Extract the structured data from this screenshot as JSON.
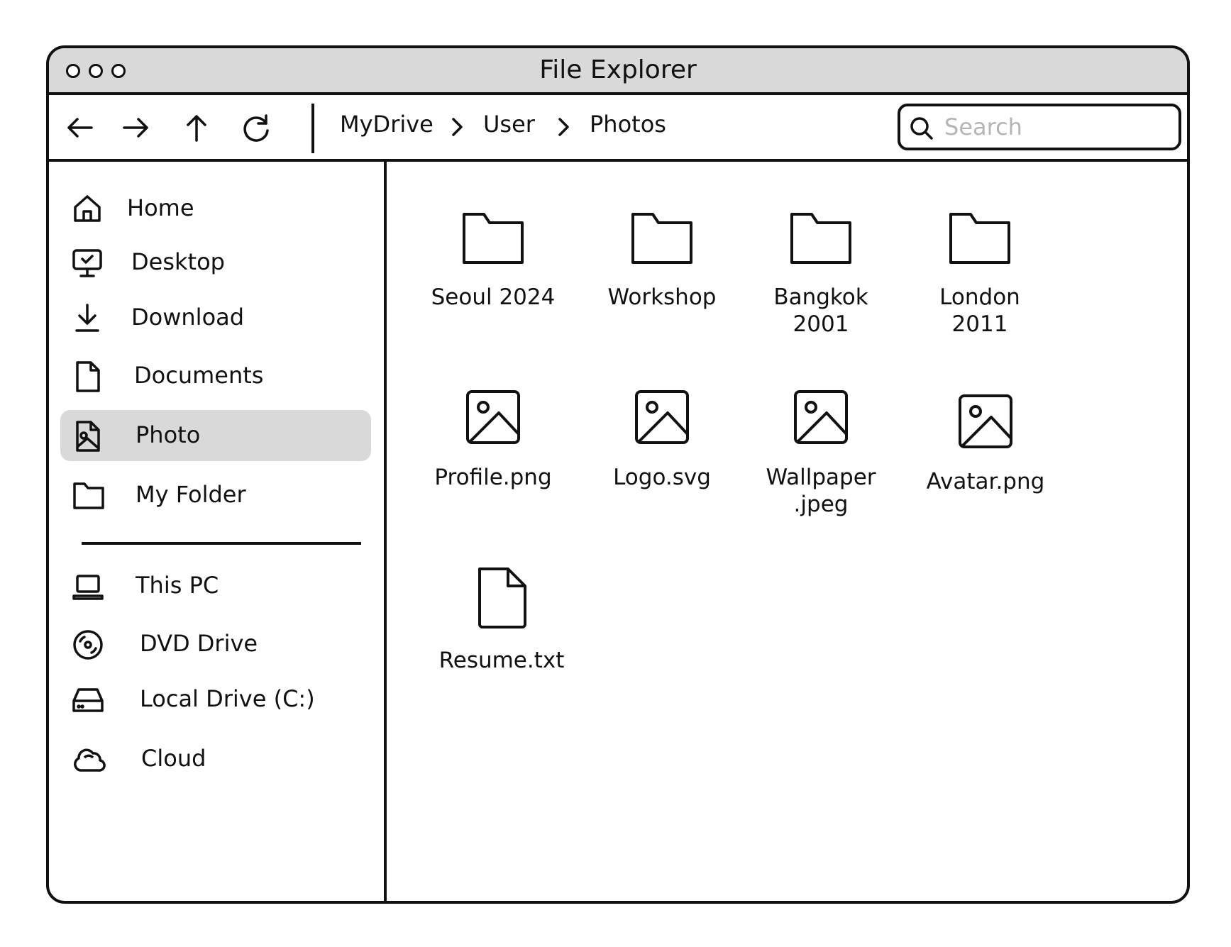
{
  "window": {
    "title": "File Explorer"
  },
  "toolbar": {
    "back_icon": "arrow-left-icon",
    "forward_icon": "arrow-right-icon",
    "up_icon": "arrow-up-icon",
    "refresh_icon": "refresh-icon",
    "breadcrumb": [
      "MyDrive",
      "User",
      "Photos"
    ],
    "search": {
      "placeholder": "Search",
      "value": ""
    }
  },
  "sidebar": {
    "items": [
      {
        "label": "Home",
        "icon": "home-icon"
      },
      {
        "label": "Desktop",
        "icon": "desktop-icon"
      },
      {
        "label": "Download",
        "icon": "download-icon"
      },
      {
        "label": "Documents",
        "icon": "document-icon"
      },
      {
        "label": "Photo",
        "icon": "photo-icon",
        "selected": true
      },
      {
        "label": "My Folder",
        "icon": "folder-icon"
      }
    ],
    "drives": [
      {
        "label": "This PC",
        "icon": "laptop-icon"
      },
      {
        "label": "DVD Drive",
        "icon": "dvd-icon"
      },
      {
        "label": "Local Drive (C:)",
        "icon": "hard-drive-icon"
      },
      {
        "label": "Cloud",
        "icon": "cloud-icon"
      }
    ]
  },
  "content": {
    "folders": [
      {
        "name": "Seoul 2024",
        "lines": [
          "Seoul 2024"
        ]
      },
      {
        "name": "Workshop",
        "lines": [
          "Workshop"
        ]
      },
      {
        "name": "Bangkok 2001",
        "lines": [
          "Bangkok",
          "2001"
        ]
      },
      {
        "name": "London 2011",
        "lines": [
          "London",
          "2011"
        ]
      }
    ],
    "images": [
      {
        "name": "Profile.png",
        "lines": [
          "Profile.png"
        ]
      },
      {
        "name": "Logo.svg",
        "lines": [
          "Logo.svg"
        ]
      },
      {
        "name": "Wallpaper.jpeg",
        "lines": [
          "Wallpaper",
          ".jpeg"
        ]
      },
      {
        "name": "Avatar.png",
        "lines": [
          "Avatar.png"
        ]
      }
    ],
    "files": [
      {
        "name": "Resume.txt",
        "lines": [
          "Resume.txt"
        ]
      }
    ]
  },
  "colors": {
    "selected_bg": "#d9d9d9",
    "titlebar_bg": "#d9d9d9",
    "stroke": "#111111",
    "placeholder": "#b5b5b5"
  }
}
